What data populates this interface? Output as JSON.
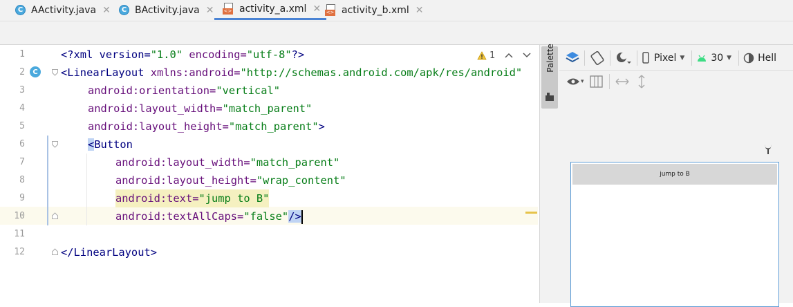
{
  "tabs": [
    {
      "label": "AActivity.java",
      "kind": "java",
      "active": false
    },
    {
      "label": "BActivity.java",
      "kind": "java",
      "active": false
    },
    {
      "label": "activity_a.xml",
      "kind": "xml",
      "active": true
    },
    {
      "label": "activity_b.xml",
      "kind": "xml",
      "active": false
    }
  ],
  "editor": {
    "line_numbers": [
      "1",
      "2",
      "3",
      "4",
      "5",
      "6",
      "7",
      "8",
      "9",
      "10",
      "11",
      "12"
    ],
    "current_line": "10",
    "inspection": {
      "count": "1"
    },
    "code": {
      "l1_a": "<?xml version=",
      "l1_b": "\"1.0\"",
      "l1_c": " encoding=",
      "l1_d": "\"utf-8\"",
      "l1_e": "?>",
      "l2_tag": "<LinearLayout",
      "l2_attr": " xmlns:android=",
      "l2_val": "\"http://schemas.android.com/apk/res/android\"",
      "l3_attr": "android:orientation=",
      "l3_val": "\"vertical\"",
      "l4_attr": "android:layout_width=",
      "l4_val": "\"match_parent\"",
      "l5_attr": "android:layout_height=",
      "l5_val": "\"match_parent\"",
      "l5_end": ">",
      "l6_lt": "<",
      "l6_tag": "Button",
      "l7_attr": "android:layout_width=",
      "l7_val": "\"match_parent\"",
      "l8_attr": "android:layout_height=",
      "l8_val": "\"wrap_content\"",
      "l9_attr": "android:text=",
      "l9_val": "\"jump to B\"",
      "l10_attr": "android:textAllCaps=",
      "l10_val": "\"false\"",
      "l10_end": "/>",
      "l12_tag": "</LinearLayout>",
      "l12_end": ">"
    }
  },
  "palette": {
    "label": "Palette"
  },
  "design_toolbar": {
    "device": "Pixel",
    "api": "30",
    "theme": "Hell"
  },
  "preview": {
    "button_text": "jump to B"
  }
}
